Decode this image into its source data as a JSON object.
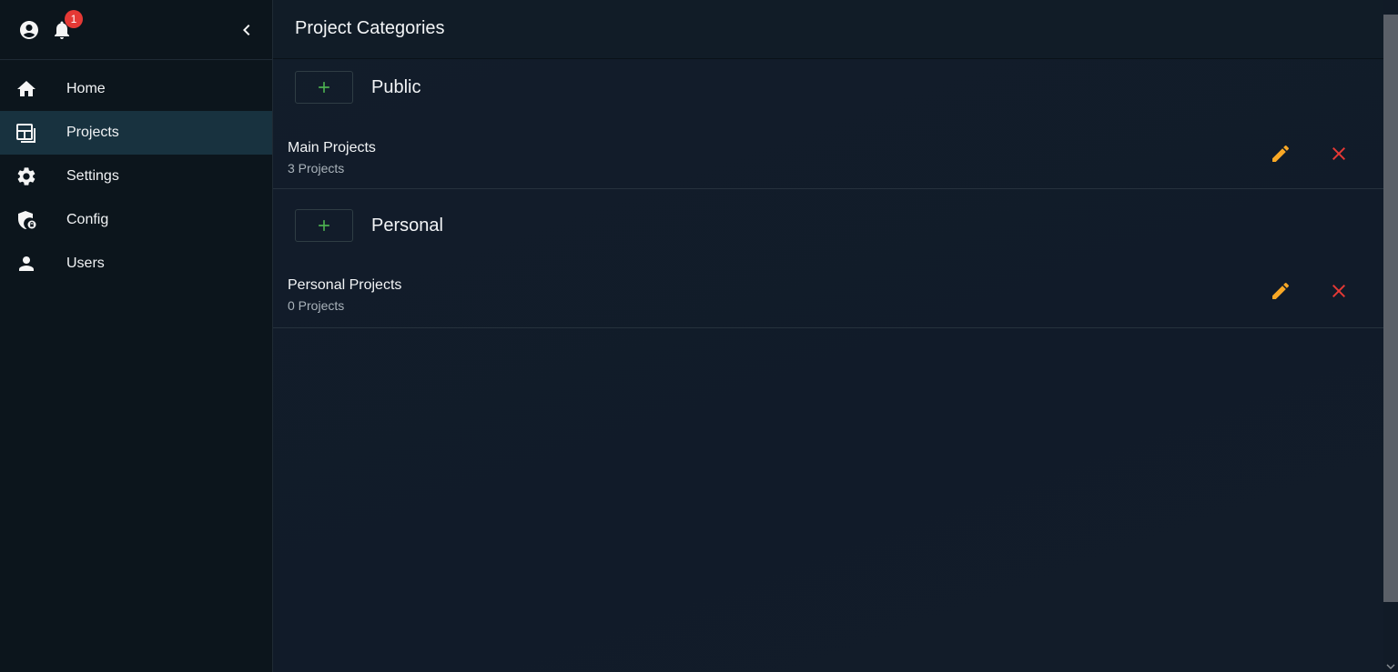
{
  "header": {
    "notification_count": "1"
  },
  "sidebar": {
    "items": [
      {
        "label": "Home",
        "icon": "home-icon"
      },
      {
        "label": "Projects",
        "icon": "projects-icon",
        "active": true
      },
      {
        "label": "Settings",
        "icon": "gear-icon"
      },
      {
        "label": "Config",
        "icon": "shield-lock-icon"
      },
      {
        "label": "Users",
        "icon": "user-icon"
      }
    ]
  },
  "main": {
    "title": "Project Categories",
    "groups": [
      {
        "title": "Public",
        "categories": [
          {
            "name": "Main Projects",
            "count": "3 Projects"
          }
        ]
      },
      {
        "title": "Personal",
        "categories": [
          {
            "name": "Personal Projects",
            "count": "0 Projects"
          }
        ]
      }
    ]
  },
  "colors": {
    "accent_add": "#4caf50",
    "edit": "#f9a825",
    "delete": "#e53935",
    "badge": "#e53935",
    "active_nav": "#18323f"
  }
}
